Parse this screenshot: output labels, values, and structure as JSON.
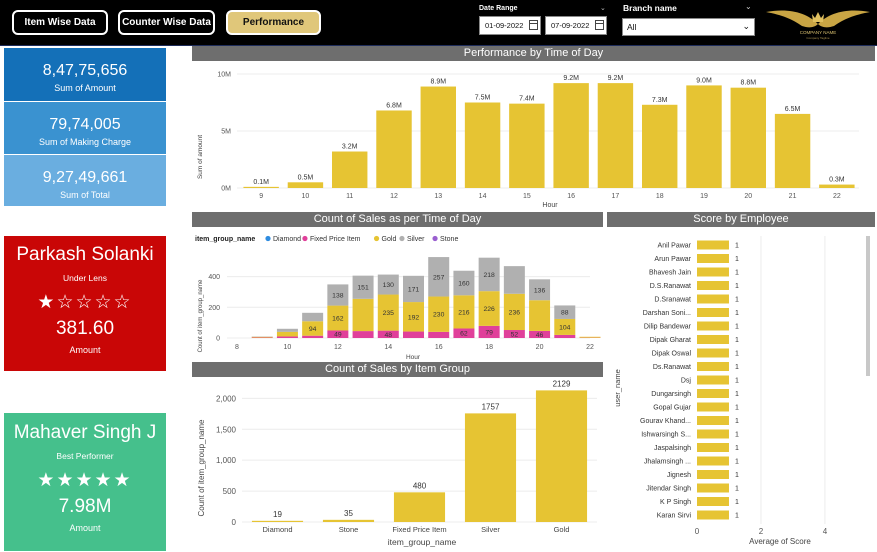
{
  "nav": {
    "item_wise": "Item Wise Data",
    "counter_wise": "Counter Wise Data",
    "performance": "Performance"
  },
  "filters": {
    "date_range_label": "Date Range",
    "date_from": "01-09-2022",
    "date_to": "07-09-2022",
    "branch_label": "Branch name",
    "branch_value": "All"
  },
  "logo": {
    "text": "COMPANY NAME",
    "subtext": "Company Tagline"
  },
  "kpis": [
    {
      "value": "8,47,75,656",
      "label": "Sum of Amount",
      "color": "#1470b8"
    },
    {
      "value": "79,74,005",
      "label": "Sum of Making Charge",
      "color": "#3a92d0"
    },
    {
      "value": "9,27,49,661",
      "label": "Sum of Total",
      "color": "#6aaee0"
    }
  ],
  "under_lens": {
    "name": "Parkash Solanki",
    "role": "Under Lens",
    "stars": "★☆☆☆☆",
    "value": "381.60",
    "unit": "Amount",
    "color": "#c90606"
  },
  "best": {
    "name": "Mahaver Singh J",
    "role": "Best Performer",
    "stars": "★★★★★",
    "value": "7.98M",
    "unit": "Amount",
    "color": "#45c08c"
  },
  "colors": {
    "gold": "#e6c433",
    "gray": "#b0b0b0",
    "pink": "#e0409a",
    "diamond": "#2f8ce0",
    "stone": "#9a5fd0"
  },
  "chart_data": [
    {
      "type": "bar",
      "title": "Performance by Time of Day",
      "xlabel": "Hour",
      "ylabel": "Sum of amount",
      "ylim": [
        0,
        10000000
      ],
      "yticks": [
        "0M",
        "5M",
        "10M"
      ],
      "categories": [
        "9",
        "10",
        "11",
        "12",
        "13",
        "14",
        "15",
        "16",
        "17",
        "18",
        "19",
        "20",
        "21",
        "22"
      ],
      "values": [
        100000,
        500000,
        3200000,
        6800000,
        8900000,
        7500000,
        7400000,
        9200000,
        9200000,
        7300000,
        9000000,
        8800000,
        6500000,
        300000
      ],
      "labels": [
        "0.1M",
        "0.5M",
        "3.2M",
        "6.8M",
        "8.9M",
        "7.5M",
        "7.4M",
        "9.2M",
        "9.2M",
        "7.3M",
        "9.0M",
        "8.8M",
        "6.5M",
        "0.3M"
      ]
    },
    {
      "type": "bar",
      "stacked": true,
      "title": "Count of Sales as per Time of Day",
      "xlabel": "Hour",
      "ylabel": "Count of item_group_name",
      "legend_title": "item_group_name",
      "legend": [
        "Diamond",
        "Fixed Price Item",
        "Gold",
        "Silver",
        "Stone"
      ],
      "ylim": [
        0,
        560
      ],
      "yticks": [
        "0",
        "200",
        "400"
      ],
      "xticks": [
        "8",
        "10",
        "12",
        "14",
        "16",
        "18",
        "20",
        "22"
      ],
      "x": [
        9,
        10,
        11,
        12,
        13,
        14,
        15,
        16,
        17,
        18,
        19,
        20,
        21,
        22
      ],
      "series": [
        {
          "name": "Fixed Price Item",
          "values": [
            3,
            10,
            15,
            49,
            45,
            48,
            42,
            40,
            62,
            79,
            52,
            46,
            20,
            2
          ],
          "labels": [
            "",
            "",
            "",
            "49",
            "",
            "48",
            "",
            "",
            "62",
            "79",
            "52",
            "46",
            "",
            ""
          ]
        },
        {
          "name": "Gold",
          "values": [
            5,
            30,
            94,
            162,
            210,
            235,
            192,
            230,
            216,
            226,
            236,
            200,
            104,
            6
          ],
          "labels": [
            "",
            "",
            "94",
            "162",
            "",
            "235",
            "192",
            "230",
            "216",
            "226",
            "236",
            "",
            "104",
            ""
          ]
        },
        {
          "name": "Silver",
          "values": [
            2,
            20,
            55,
            138,
            151,
            130,
            171,
            257,
            160,
            218,
            180,
            136,
            88,
            0
          ],
          "labels": [
            "",
            "",
            "",
            "138",
            "151",
            "130",
            "171",
            "257",
            "160",
            "218",
            "",
            "136",
            "88",
            ""
          ]
        }
      ]
    },
    {
      "type": "bar",
      "title": "Count of Sales by Item Group",
      "xlabel": "item_group_name",
      "ylabel": "Count of item_group_name",
      "ylim": [
        0,
        2200
      ],
      "yticks": [
        "0",
        "500",
        "1,000",
        "1,500",
        "2,000"
      ],
      "categories": [
        "Diamond",
        "Stone",
        "Fixed Price Item",
        "Silver",
        "Gold"
      ],
      "values": [
        19,
        35,
        480,
        1757,
        2129
      ]
    },
    {
      "type": "bar",
      "orientation": "horizontal",
      "title": "Score by Employee",
      "xlabel": "Average of Score",
      "ylabel": "user_name",
      "xlim": [
        0,
        5
      ],
      "xticks": [
        "0",
        "2",
        "4"
      ],
      "categories": [
        "Anil Pawar",
        "Arun Pawar",
        "Bhavesh Jain",
        "D.S.Ranawat",
        "D.Sranawat",
        "Darshan Soni...",
        "Dilip Bandewar",
        "Dipak Gharat",
        "Dipak Oswal",
        "Ds.Ranawat",
        "Dsj",
        "Dungarsingh",
        "Gopal Gujar",
        "Gourav Khand...",
        "Ishwarsingh S...",
        "Jaspalsingh",
        "Jhalamsingh ...",
        "Jignesh",
        "Jitendar Singh",
        "K P Singh",
        "Karan Sirvi"
      ],
      "values": [
        1,
        1,
        1,
        1,
        1,
        1,
        1,
        1,
        1,
        1,
        1,
        1,
        1,
        1,
        1,
        1,
        1,
        1,
        1,
        1,
        1
      ]
    }
  ]
}
